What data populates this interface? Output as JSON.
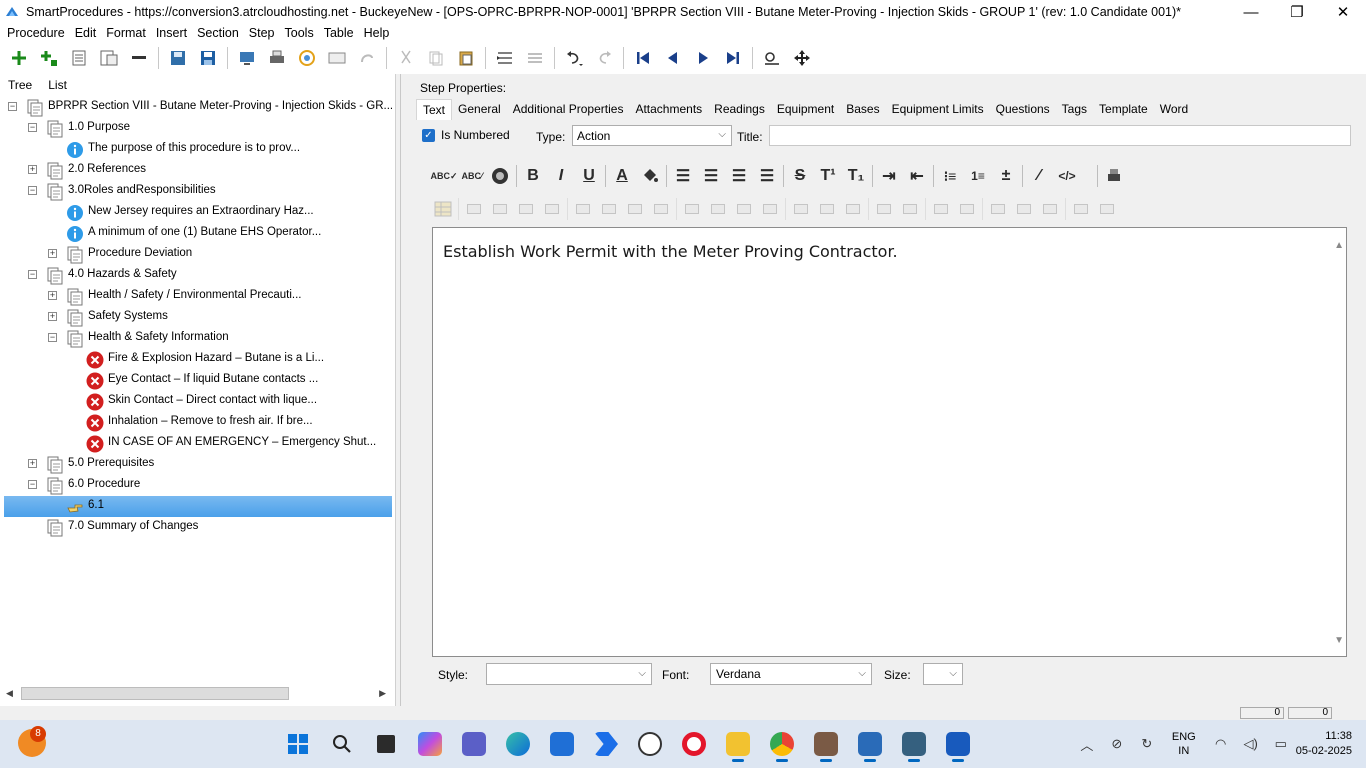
{
  "window": {
    "title": "SmartProcedures - https://conversion3.atrcloudhosting.net - BuckeyeNew - [OPS-OPRC-BPRPR-NOP-0001] 'BPRPR Section VIII - Butane Meter-Proving - Injection Skids - GROUP 1' (rev: 1.0 Candidate 001)*",
    "minimize": "—",
    "maximize": "❐",
    "close": "✕"
  },
  "menu": {
    "procedure": "Procedure",
    "edit": "Edit",
    "format": "Format",
    "insert": "Insert",
    "section": "Section",
    "step": "Step",
    "tools": "Tools",
    "table": "Table",
    "help": "Help"
  },
  "left_tabs": {
    "tree": "Tree",
    "list": "List"
  },
  "tree": [
    {
      "label": "BPRPR Section VIII - Butane Meter-Proving - Injection Skids - GR...",
      "indent": 0,
      "expander": "minus",
      "icon": "doc"
    },
    {
      "label": "1.0 Purpose",
      "indent": 1,
      "expander": "minus",
      "icon": "doc"
    },
    {
      "label": "The purpose of this procedure is to prov...",
      "indent": 2,
      "expander": "",
      "icon": "info"
    },
    {
      "label": "2.0 References",
      "indent": 1,
      "expander": "plus",
      "icon": "doc"
    },
    {
      "label": "3.0Roles andResponsibilities",
      "indent": 1,
      "expander": "minus",
      "icon": "doc"
    },
    {
      "label": "New Jersey requires an Extraordinary Haz...",
      "indent": 2,
      "expander": "",
      "icon": "info"
    },
    {
      "label": "A minimum of one (1) Butane EHS Operator...",
      "indent": 2,
      "expander": "",
      "icon": "info"
    },
    {
      "label": "Procedure Deviation",
      "indent": 2,
      "expander": "plus",
      "icon": "doc"
    },
    {
      "label": "4.0 Hazards & Safety",
      "indent": 1,
      "expander": "minus",
      "icon": "doc"
    },
    {
      "label": "Health / Safety / Environmental Precauti...",
      "indent": 2,
      "expander": "plus",
      "icon": "doc"
    },
    {
      "label": "Safety Systems",
      "indent": 2,
      "expander": "plus",
      "icon": "doc"
    },
    {
      "label": "Health & Safety Information",
      "indent": 2,
      "expander": "minus",
      "icon": "doc"
    },
    {
      "label": "Fire & Explosion Hazard – Butane is a Li...",
      "indent": 3,
      "expander": "",
      "icon": "warn"
    },
    {
      "label": "Eye Contact – If liquid Butane contacts ...",
      "indent": 3,
      "expander": "",
      "icon": "warn"
    },
    {
      "label": "Skin Contact – Direct contact with lique...",
      "indent": 3,
      "expander": "",
      "icon": "warn"
    },
    {
      "label": "Inhalation – Remove to fresh air. If bre...",
      "indent": 3,
      "expander": "",
      "icon": "warn"
    },
    {
      "label": "IN CASE OF AN EMERGENCY – Emergency Shut...",
      "indent": 3,
      "expander": "",
      "icon": "warn"
    },
    {
      "label": "5.0 Prerequisites",
      "indent": 1,
      "expander": "plus",
      "icon": "doc"
    },
    {
      "label": "6.0 Procedure",
      "indent": 1,
      "expander": "minus",
      "icon": "doc"
    },
    {
      "label": "6.1",
      "indent": 2,
      "expander": "",
      "icon": "hand",
      "selected": true
    },
    {
      "label": "7.0 Summary of Changes",
      "indent": 1,
      "expander": "",
      "icon": "doc"
    }
  ],
  "step_properties": {
    "heading": "Step Properties:",
    "tabs": [
      "Text",
      "General",
      "Additional Properties",
      "Attachments",
      "Readings",
      "Equipment",
      "Bases",
      "Equipment Limits",
      "Questions",
      "Tags",
      "Template",
      "Word"
    ],
    "active_tab": "Text",
    "is_numbered_label": "Is Numbered",
    "is_numbered_checked": true,
    "type_label": "Type:",
    "type_value": "Action",
    "title_label": "Title:",
    "title_value": "",
    "editor_text": "Establish Work Permit with the Meter Proving Contractor.",
    "style_label": "Style:",
    "style_value": "",
    "font_label": "Font:",
    "font_value": "Verdana",
    "size_label": "Size:",
    "size_value": ""
  },
  "status": {
    "val1": "0",
    "val2": "0"
  },
  "taskbar": {
    "weather_badge": "8",
    "lang_line1": "ENG",
    "lang_line2": "IN",
    "time": "11:38",
    "date": "05-02-2025"
  }
}
